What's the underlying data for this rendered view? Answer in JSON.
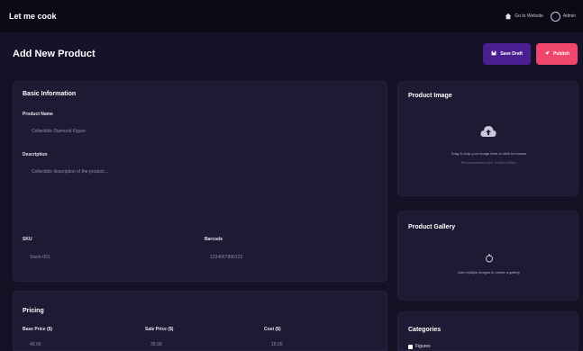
{
  "app": {
    "brand": "Let me cook"
  },
  "topbar": {
    "go_to_website": "Go to Website",
    "admin": "Admin"
  },
  "header": {
    "title": "Add New Product",
    "save_draft": "Save Draft",
    "publish": "Publish"
  },
  "basic_info": {
    "title": "Basic Information",
    "product_name_label": "Product Name",
    "product_name_placeholder": "Collectible Diamond Figure",
    "description_label": "Description",
    "description_placeholder": "Collectible description of the product...",
    "sku_label": "SKU",
    "sku_placeholder": "Stock-001",
    "barcode_label": "Barcode",
    "barcode_placeholder": "1234567890123"
  },
  "pricing": {
    "title": "Pricing",
    "base_price_label": "Base Price ($)",
    "base_price_value": "40.00",
    "sale_price_label": "Sale Price ($)",
    "sale_price_value": "35.00",
    "cost_label": "Cost ($)",
    "cost_value": "15.00"
  },
  "product_image": {
    "title": "Product Image",
    "drop_text": "Drag & drop your image here or click to browse",
    "drop_subtext": "Recommended size: 1000x1000px"
  },
  "product_gallery": {
    "title": "Product Gallery",
    "gallery_text": "Add multiple images to create a gallery"
  },
  "categories": {
    "title": "Categories",
    "first_item": "Figures"
  },
  "colors": {
    "draft": "#4a1f8f",
    "publish": "#f0466b"
  }
}
